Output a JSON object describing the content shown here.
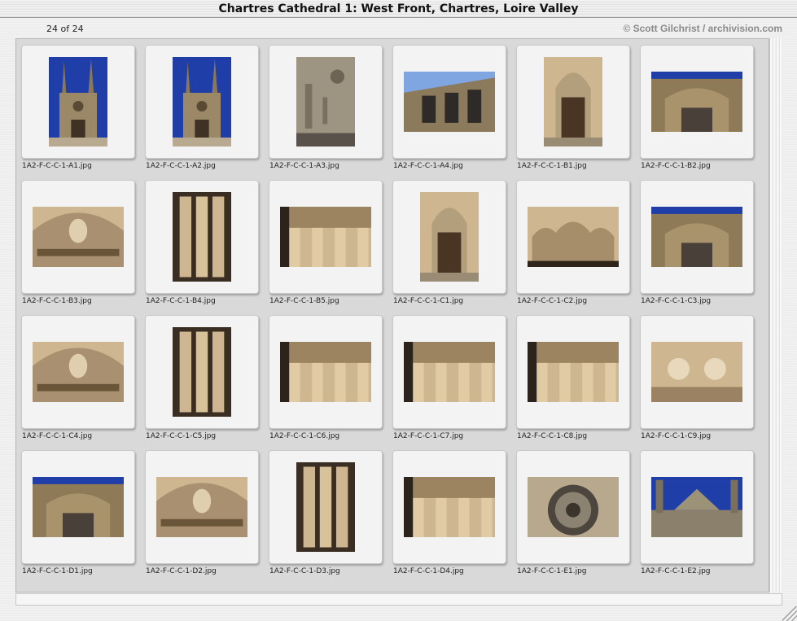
{
  "window": {
    "title": "Chartres Cathedral 1: West Front, Chartres, Loire Valley",
    "count": "24 of 24",
    "credit": "© Scott Gilchrist / archivision.com"
  },
  "thumbnails": [
    {
      "file": "1A2-F-C-C-1-A1.jpg",
      "orient": "portrait",
      "icon": "cathedral-facade-photo"
    },
    {
      "file": "1A2-F-C-C-1-A2.jpg",
      "orient": "portrait",
      "icon": "cathedral-facade-photo"
    },
    {
      "file": "1A2-F-C-C-1-A3.jpg",
      "orient": "portrait",
      "icon": "tower-rose-window-photo"
    },
    {
      "file": "1A2-F-C-C-1-A4.jpg",
      "orient": "landscape",
      "icon": "facade-windows-photo"
    },
    {
      "file": "1A2-F-C-C-1-B1.jpg",
      "orient": "portrait",
      "icon": "portal-door-photo"
    },
    {
      "file": "1A2-F-C-C-1-B2.jpg",
      "orient": "landscape",
      "icon": "portal-sky-photo"
    },
    {
      "file": "1A2-F-C-C-1-B3.jpg",
      "orient": "landscape",
      "icon": "tympanum-photo"
    },
    {
      "file": "1A2-F-C-C-1-B4.jpg",
      "orient": "portrait",
      "icon": "column-statues-photo"
    },
    {
      "file": "1A2-F-C-C-1-B5.jpg",
      "orient": "landscape",
      "icon": "capitals-frieze-photo"
    },
    {
      "file": "1A2-F-C-C-1-C1.jpg",
      "orient": "portrait",
      "icon": "portal-door-photo"
    },
    {
      "file": "1A2-F-C-C-1-C2.jpg",
      "orient": "landscape",
      "icon": "portal-arches-photo"
    },
    {
      "file": "1A2-F-C-C-1-C3.jpg",
      "orient": "landscape",
      "icon": "portal-sky-photo"
    },
    {
      "file": "1A2-F-C-C-1-C4.jpg",
      "orient": "landscape",
      "icon": "tympanum-photo"
    },
    {
      "file": "1A2-F-C-C-1-C5.jpg",
      "orient": "portrait",
      "icon": "column-statues-photo"
    },
    {
      "file": "1A2-F-C-C-1-C6.jpg",
      "orient": "landscape",
      "icon": "statues-photo"
    },
    {
      "file": "1A2-F-C-C-1-C7.jpg",
      "orient": "landscape",
      "icon": "capitals-frieze-photo"
    },
    {
      "file": "1A2-F-C-C-1-C8.jpg",
      "orient": "landscape",
      "icon": "capitals-frieze-photo"
    },
    {
      "file": "1A2-F-C-C-1-C9.jpg",
      "orient": "landscape",
      "icon": "statue-heads-photo"
    },
    {
      "file": "1A2-F-C-C-1-D1.jpg",
      "orient": "landscape",
      "icon": "portal-sky-photo"
    },
    {
      "file": "1A2-F-C-C-1-D2.jpg",
      "orient": "landscape",
      "icon": "tympanum-photo"
    },
    {
      "file": "1A2-F-C-C-1-D3.jpg",
      "orient": "portrait",
      "icon": "column-statues-photo"
    },
    {
      "file": "1A2-F-C-C-1-D4.jpg",
      "orient": "landscape",
      "icon": "capitals-frieze-photo"
    },
    {
      "file": "1A2-F-C-C-1-E1.jpg",
      "orient": "landscape",
      "icon": "rose-window-photo"
    },
    {
      "file": "1A2-F-C-C-1-E2.jpg",
      "orient": "landscape",
      "icon": "gable-sky-photo"
    }
  ],
  "colors": {
    "stone_light": "#cdb690",
    "stone_dark": "#6a5538",
    "sky_blue": "#1f3ea8",
    "door_brown": "#4a3424"
  }
}
